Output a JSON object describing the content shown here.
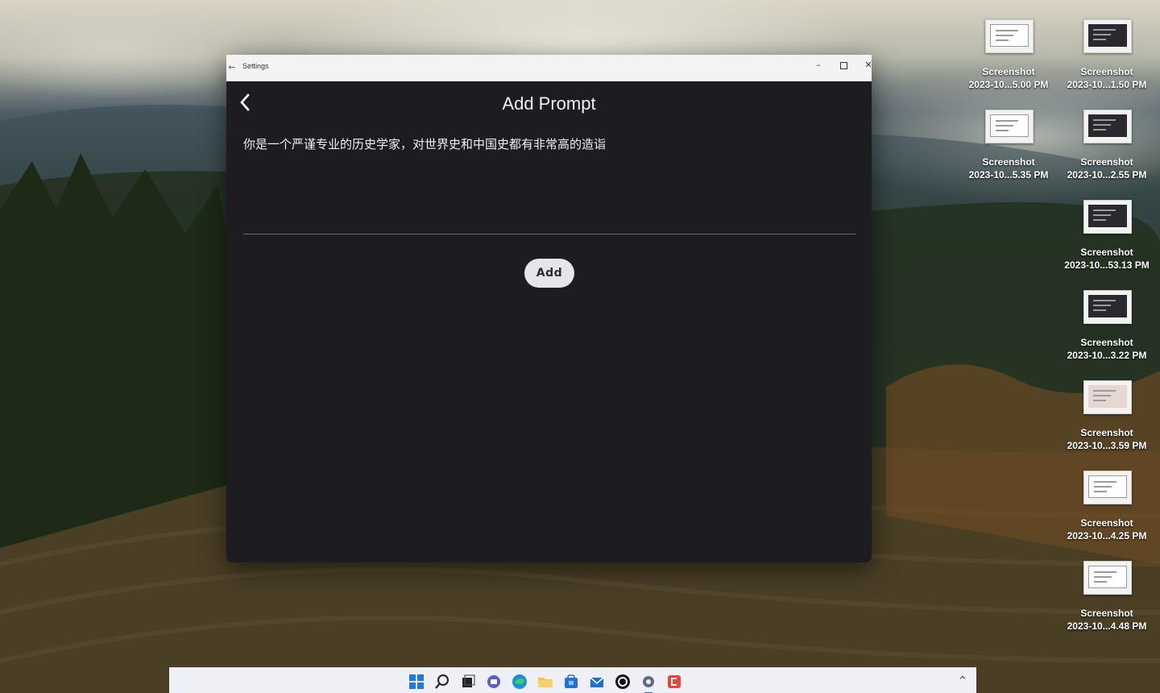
{
  "window": {
    "title": "Settings",
    "page_title": "Add Prompt",
    "prompt_text": "你是一个严谨专业的历史学家，对世界史和中国史都有非常高的造诣",
    "add_label": "Add"
  },
  "desktop": {
    "icons": [
      {
        "name": "Screenshot",
        "date": "2023-10...5.00 PM",
        "thumb": "light"
      },
      {
        "name": "Screenshot",
        "date": "2023-10...1.50 PM",
        "thumb": "dark"
      },
      {
        "name": "Screenshot",
        "date": "2023-10...5.35 PM",
        "thumb": "light"
      },
      {
        "name": "Screenshot",
        "date": "2023-10...2.55 PM",
        "thumb": "dark"
      },
      {
        "name": "Screenshot",
        "date": "2023-10...53.13 PM",
        "thumb": "dark"
      },
      {
        "name": "Screenshot",
        "date": "2023-10...3.22 PM",
        "thumb": "dark"
      },
      {
        "name": "Screenshot",
        "date": "2023-10...3.59 PM",
        "thumb": "pic"
      },
      {
        "name": "Screenshot",
        "date": "2023-10...4.25 PM",
        "thumb": "light"
      },
      {
        "name": "Screenshot",
        "date": "2023-10...4.48 PM",
        "thumb": "light"
      }
    ]
  },
  "taskbar": {
    "icons": [
      "windows-start-icon",
      "search-icon",
      "task-view-icon",
      "chat-icon",
      "edge-icon",
      "file-explorer-icon",
      "store-icon",
      "mail-icon",
      "chatgpt-icon",
      "settings-icon",
      "app-icon"
    ]
  },
  "colors": {
    "window_bg": "#1d1c21",
    "button_bg": "#e7e5e8",
    "titlebar_bg": "#f3f3f3"
  }
}
